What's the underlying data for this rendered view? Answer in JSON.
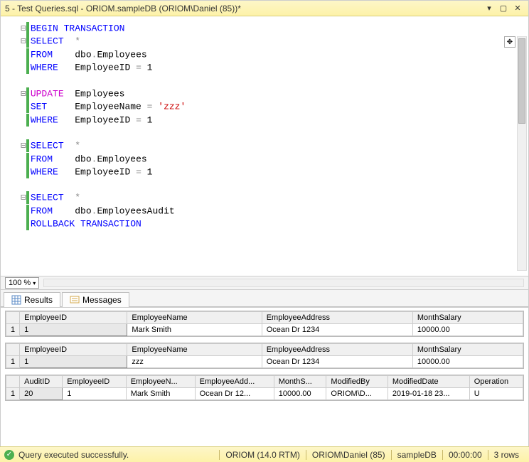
{
  "title": "5 - Test Queries.sql - ORIOM.sampleDB (ORIOM\\Daniel (85))*",
  "window_buttons": {
    "dropdown": "▾",
    "float": "▢",
    "close": "✕"
  },
  "outline_toggle": "✥",
  "zoom": "100 %",
  "code_lines": [
    {
      "fold": "⊟",
      "bar": true,
      "tokens": [
        {
          "t": "BEGIN TRANSACTION",
          "c": "kw-blue"
        }
      ]
    },
    {
      "fold": "⊟",
      "bar": true,
      "tokens": [
        {
          "t": "SELECT",
          "c": "kw-blue"
        },
        {
          "t": "  "
        },
        {
          "t": "*",
          "c": "kw-gray"
        }
      ]
    },
    {
      "fold": " ",
      "bar": true,
      "tokens": [
        {
          "t": "FROM",
          "c": "kw-blue"
        },
        {
          "t": "    "
        },
        {
          "t": "dbo",
          "c": ""
        },
        {
          "t": ".",
          "c": "kw-gray"
        },
        {
          "t": "Employees",
          "c": ""
        }
      ]
    },
    {
      "fold": " ",
      "bar": true,
      "tokens": [
        {
          "t": "WHERE",
          "c": "kw-blue"
        },
        {
          "t": "   "
        },
        {
          "t": "EmployeeID ",
          "c": ""
        },
        {
          "t": "= ",
          "c": "kw-gray"
        },
        {
          "t": "1",
          "c": ""
        }
      ]
    },
    {
      "blank": true
    },
    {
      "fold": "⊟",
      "bar": true,
      "tokens": [
        {
          "t": "UPDATE",
          "c": "kw-magenta"
        },
        {
          "t": "  "
        },
        {
          "t": "Employees",
          "c": ""
        }
      ]
    },
    {
      "fold": " ",
      "bar": true,
      "tokens": [
        {
          "t": "SET",
          "c": "kw-blue"
        },
        {
          "t": "     "
        },
        {
          "t": "EmployeeName ",
          "c": ""
        },
        {
          "t": "= ",
          "c": "kw-gray"
        },
        {
          "t": "'zzz'",
          "c": "kw-red"
        }
      ]
    },
    {
      "fold": " ",
      "bar": true,
      "tokens": [
        {
          "t": "WHERE",
          "c": "kw-blue"
        },
        {
          "t": "   "
        },
        {
          "t": "EmployeeID ",
          "c": ""
        },
        {
          "t": "= ",
          "c": "kw-gray"
        },
        {
          "t": "1",
          "c": ""
        }
      ]
    },
    {
      "blank": true
    },
    {
      "fold": "⊟",
      "bar": true,
      "tokens": [
        {
          "t": "SELECT",
          "c": "kw-blue"
        },
        {
          "t": "  "
        },
        {
          "t": "*",
          "c": "kw-gray"
        }
      ]
    },
    {
      "fold": " ",
      "bar": true,
      "tokens": [
        {
          "t": "FROM",
          "c": "kw-blue"
        },
        {
          "t": "    "
        },
        {
          "t": "dbo",
          "c": ""
        },
        {
          "t": ".",
          "c": "kw-gray"
        },
        {
          "t": "Employees",
          "c": ""
        }
      ]
    },
    {
      "fold": " ",
      "bar": true,
      "tokens": [
        {
          "t": "WHERE",
          "c": "kw-blue"
        },
        {
          "t": "   "
        },
        {
          "t": "EmployeeID ",
          "c": ""
        },
        {
          "t": "= ",
          "c": "kw-gray"
        },
        {
          "t": "1",
          "c": ""
        }
      ]
    },
    {
      "blank": true
    },
    {
      "fold": "⊟",
      "bar": true,
      "tokens": [
        {
          "t": "SELECT",
          "c": "kw-blue"
        },
        {
          "t": "  "
        },
        {
          "t": "*",
          "c": "kw-gray"
        }
      ]
    },
    {
      "fold": " ",
      "bar": true,
      "tokens": [
        {
          "t": "FROM",
          "c": "kw-blue"
        },
        {
          "t": "    "
        },
        {
          "t": "dbo",
          "c": ""
        },
        {
          "t": ".",
          "c": "kw-gray"
        },
        {
          "t": "EmployeesAudit",
          "c": ""
        }
      ]
    },
    {
      "fold": " ",
      "bar": true,
      "tokens": [
        {
          "t": "ROLLBACK TRANSACTION",
          "c": "kw-blue"
        }
      ]
    }
  ],
  "tabs": {
    "results": "Results",
    "messages": "Messages"
  },
  "grids": [
    {
      "headers": [
        "EmployeeID",
        "EmployeeName",
        "EmployeeAddress",
        "MonthSalary"
      ],
      "rows": [
        {
          "n": "1",
          "cells": [
            "1",
            "Mark Smith",
            "Ocean Dr 1234",
            "10000.00"
          ],
          "selcol": 0
        }
      ]
    },
    {
      "headers": [
        "EmployeeID",
        "EmployeeName",
        "EmployeeAddress",
        "MonthSalary"
      ],
      "rows": [
        {
          "n": "1",
          "cells": [
            "1",
            "zzz",
            "Ocean Dr 1234",
            "10000.00"
          ],
          "selcol": 0
        }
      ]
    },
    {
      "headers": [
        "AuditID",
        "EmployeeID",
        "EmployeeN...",
        "EmployeeAdd...",
        "MonthS...",
        "ModifiedBy",
        "ModifiedDate",
        "Operation"
      ],
      "rows": [
        {
          "n": "1",
          "cells": [
            "20",
            "1",
            "Mark Smith",
            "Ocean Dr 12...",
            "10000.00",
            "ORIOM\\D...",
            "2019-01-18 23...",
            "U"
          ],
          "selcol": 0
        }
      ]
    }
  ],
  "status": {
    "msg": "Query executed successfully.",
    "server": "ORIOM (14.0 RTM)",
    "user": "ORIOM\\Daniel (85)",
    "db": "sampleDB",
    "time": "00:00:00",
    "rows": "3 rows"
  }
}
